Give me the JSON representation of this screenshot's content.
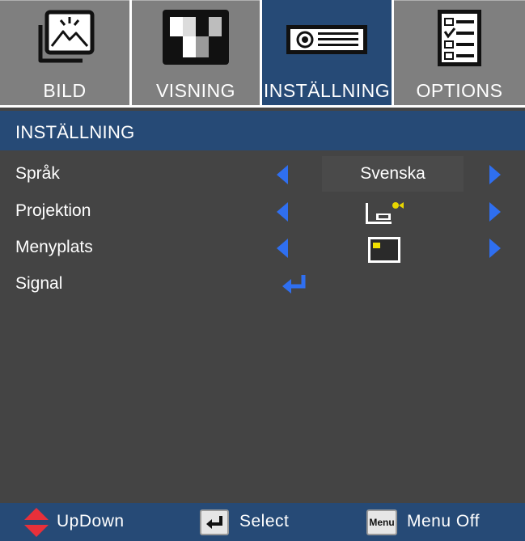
{
  "tabs": [
    {
      "label": "BILD",
      "icon": "picture-icon",
      "active": false
    },
    {
      "label": "VISNING",
      "icon": "display-pattern-icon",
      "active": false
    },
    {
      "label": "INSTÄLLNING",
      "icon": "projector-icon",
      "active": true
    },
    {
      "label": "OPTIONS",
      "icon": "checklist-icon",
      "active": false
    }
  ],
  "section": {
    "title": "INSTÄLLNING"
  },
  "rows": [
    {
      "label": "Språk",
      "value": "Svenska",
      "value_icon": ""
    },
    {
      "label": "Projektion",
      "value": "",
      "value_icon": "projection-mode-icon"
    },
    {
      "label": "Menyplats",
      "value": "",
      "value_icon": "menu-location-icon"
    },
    {
      "label": "Signal",
      "value": "",
      "value_icon": "enter-icon"
    }
  ],
  "footer": {
    "updown": "UpDown",
    "select": "Select",
    "menu_key": "Menu",
    "menu_off": "Menu Off"
  },
  "colors": {
    "accent": "#264a76",
    "arrow": "#2f6ff0",
    "background": "#444444",
    "tab_inactive": "#7f7f7f"
  }
}
